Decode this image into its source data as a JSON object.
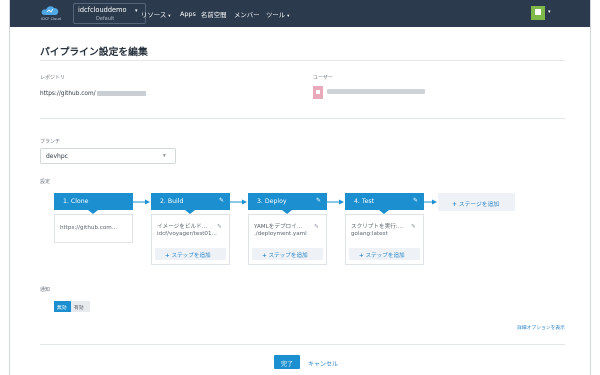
{
  "nav": {
    "logo_text": "IDCF Cloud",
    "project_name": "idcfclouddemo",
    "project_sub": "Default",
    "items": [
      {
        "label": "リソース",
        "caret": "▾"
      },
      {
        "label": "Apps"
      },
      {
        "label": "名前空間"
      },
      {
        "label": "メンバー"
      },
      {
        "label": "ツール",
        "caret": "▾"
      }
    ],
    "caret_glyph": "▾"
  },
  "page": {
    "title": "パイプライン設定を編集"
  },
  "repository": {
    "label": "レポジトリ",
    "url_prefix": "https://github.com/"
  },
  "user": {
    "label": "ユーザー"
  },
  "branch": {
    "label": "ブランチ",
    "value": "devhpc"
  },
  "settings": {
    "label": "設定"
  },
  "stages": [
    {
      "title": "1. Clone",
      "steps": [
        "https://github.com..."
      ],
      "add_step_label": ""
    },
    {
      "title": "2. Build",
      "steps": [
        "イメージをビルド...",
        "idcf/voyager/test01..."
      ],
      "add_step_label": "ステップを追加"
    },
    {
      "title": "3. Deploy",
      "steps": [
        "YAMLをデプロイ...",
        "./deployment.yaml"
      ],
      "add_step_label": "ステップを追加"
    },
    {
      "title": "4. Test",
      "steps": [
        "スクリプトを実行:...",
        "golang:latest"
      ],
      "add_step_label": "ステップを追加"
    }
  ],
  "add_stage_label": "ステージを追加",
  "plus_glyph": "+",
  "edit_glyph": "✎",
  "notify": {
    "label": "通知",
    "on_label": "無効",
    "off_label": "有効",
    "selected": "無効"
  },
  "advanced_link": "詳細オプションを表示",
  "footer": {
    "done_label": "完了",
    "cancel_label": "キャンセル"
  },
  "colors": {
    "nav_bg": "#2b3a4c",
    "accent": "#1b8fd0",
    "link": "#2d86c9"
  }
}
